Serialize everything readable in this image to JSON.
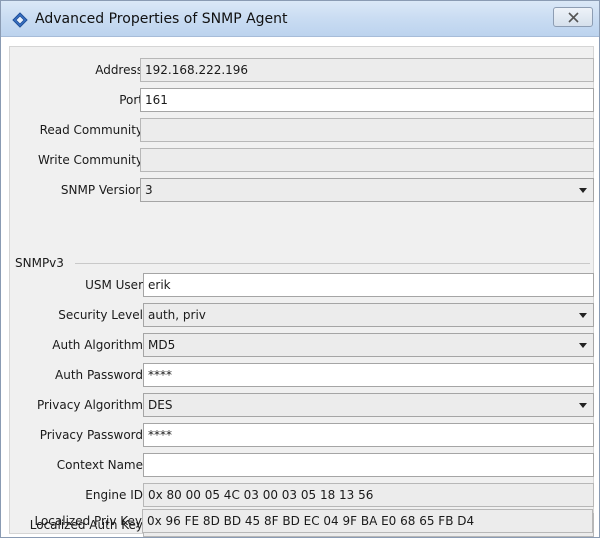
{
  "window": {
    "title": "Advanced Properties of SNMP Agent",
    "accent": "#3a72c4"
  },
  "fields": {
    "address": {
      "label": "Address",
      "value": "192.168.222.196"
    },
    "port": {
      "label": "Port",
      "value": "161"
    },
    "read_comm": {
      "label": "Read Community",
      "value": ""
    },
    "write_comm": {
      "label": "Write Community",
      "value": ""
    },
    "snmp_version": {
      "label": "SNMP Version",
      "value": "3"
    }
  },
  "snmpv3": {
    "title": "SNMPv3",
    "usm_user": {
      "label": "USM User",
      "value": "erik"
    },
    "security_level": {
      "label": "Security Level",
      "value": "auth, priv"
    },
    "auth_algorithm": {
      "label": "Auth Algorithm",
      "value": "MD5"
    },
    "auth_password": {
      "label": "Auth Password",
      "value": "****"
    },
    "priv_algorithm": {
      "label": "Privacy Algorithm",
      "value": "DES"
    },
    "priv_password": {
      "label": "Privacy Password",
      "value": "****"
    },
    "context_name": {
      "label": "Context Name",
      "value": ""
    },
    "engine_id": {
      "label": "Engine ID",
      "value": "0x 80 00 05 4C 03 00 03 05 18 13 56"
    },
    "loc_auth_key": {
      "label": "Localized Auth Key",
      "value": "0x 96 FE 8D BD 45 8F BD EC 04 9F BA E0 68 65 FB D4"
    },
    "loc_priv_key": {
      "label": "Localized Priv Key",
      "value": "0x 96 FE 8D BD 45 8F BD EC 04 9F BA E0 68 65 FB D4"
    }
  },
  "icons": {
    "title": "diamond-window-icon",
    "close": "close-icon",
    "dropdown": "chevron-down-icon"
  }
}
